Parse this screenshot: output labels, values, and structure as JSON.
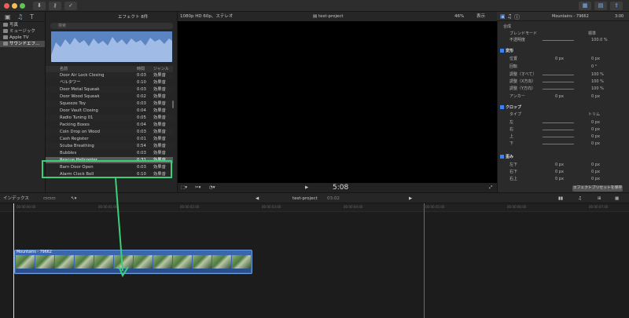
{
  "toolbar": {
    "time": "3:00"
  },
  "sidebar": {
    "items": [
      {
        "label": "写真"
      },
      {
        "label": "ミュージック"
      },
      {
        "label": "Apple TV"
      },
      {
        "label": "サウンドエフ..."
      }
    ]
  },
  "browser": {
    "title": "エフェクト 8件",
    "search_placeholder": "検索",
    "columns": {
      "name": "名前",
      "duration": "時間",
      "genre": "ジャンル"
    },
    "rows": [
      {
        "name": "Door Air Lock Closing",
        "duration": "0:03",
        "genre": "効果音"
      },
      {
        "name": "ベルタワー",
        "duration": "0:10",
        "genre": "効果音"
      },
      {
        "name": "Door Metal Squeak",
        "duration": "0:03",
        "genre": "効果音"
      },
      {
        "name": "Door Wood Squeak",
        "duration": "0:02",
        "genre": "効果音"
      },
      {
        "name": "Squeeze Toy",
        "duration": "0:03",
        "genre": "効果音"
      },
      {
        "name": "Door Vault Closing",
        "duration": "0:04",
        "genre": "効果音"
      },
      {
        "name": "Radio Tuning 01",
        "duration": "0:05",
        "genre": "効果音"
      },
      {
        "name": "Packing Boxes",
        "duration": "0:04",
        "genre": "効果音"
      },
      {
        "name": "Coin Drop on Wood",
        "duration": "0:03",
        "genre": "効果音"
      },
      {
        "name": "Cash Register",
        "duration": "0:01",
        "genre": "効果音"
      },
      {
        "name": "Scuba Breathing",
        "duration": "0:54",
        "genre": "効果音"
      },
      {
        "name": "Bubbles",
        "duration": "0:03",
        "genre": "効果音"
      },
      {
        "name": "Rescue Helicopter",
        "duration": "0:31",
        "genre": "効果音"
      },
      {
        "name": "Barn Door Open",
        "duration": "0:03",
        "genre": "効果音"
      },
      {
        "name": "Alarm Clock Bell",
        "duration": "0:10",
        "genre": "効果音"
      }
    ],
    "selected_index": 12
  },
  "viewer": {
    "format": "1080p HD 60p、ステレオ",
    "project": "test-project",
    "zoom": "46%",
    "view": "表示",
    "timecode": "5:08"
  },
  "inspector": {
    "clip_name": "Mountains - 79662",
    "clip_time": "3:00",
    "sections": {
      "composite": "合成",
      "blend_label": "ブレンドモード",
      "blend_value": "標準",
      "opacity_label": "不透明度",
      "opacity_value": "100.0 %",
      "transform": "変形",
      "position": "位置",
      "rotation": "回転",
      "scale_all": "調整（すべて）",
      "scale_x": "調整（X方向）",
      "scale_y": "調整（Y方向）",
      "anchor": "アンカー",
      "crop": "クロップ",
      "crop_type_label": "タイプ",
      "crop_type": "トリム",
      "left": "左",
      "right": "右",
      "top": "上",
      "bottom": "下",
      "distort": "歪み",
      "bl": "左下",
      "br": "右下",
      "tr": "右上"
    },
    "values": {
      "px": "0 px",
      "rot": "0 °",
      "pct": "100 %"
    },
    "save_button": "エフェクトプリセットを保存"
  },
  "timeline": {
    "index_label": "インデックス",
    "project": "test-project",
    "duration": "03:02",
    "clip_label": "Mountains - 79662",
    "ticks": [
      "00:00:00:00",
      "00:00:01:00",
      "00:00:02:00",
      "00:00:03:00",
      "00:00:04:00",
      "00:00:05:00",
      "00:00:06:00",
      "00:00:07:00"
    ]
  },
  "colors": {
    "accent": "#3ad07a",
    "clip": "#3a66b0",
    "playhead": "#d0442c"
  }
}
